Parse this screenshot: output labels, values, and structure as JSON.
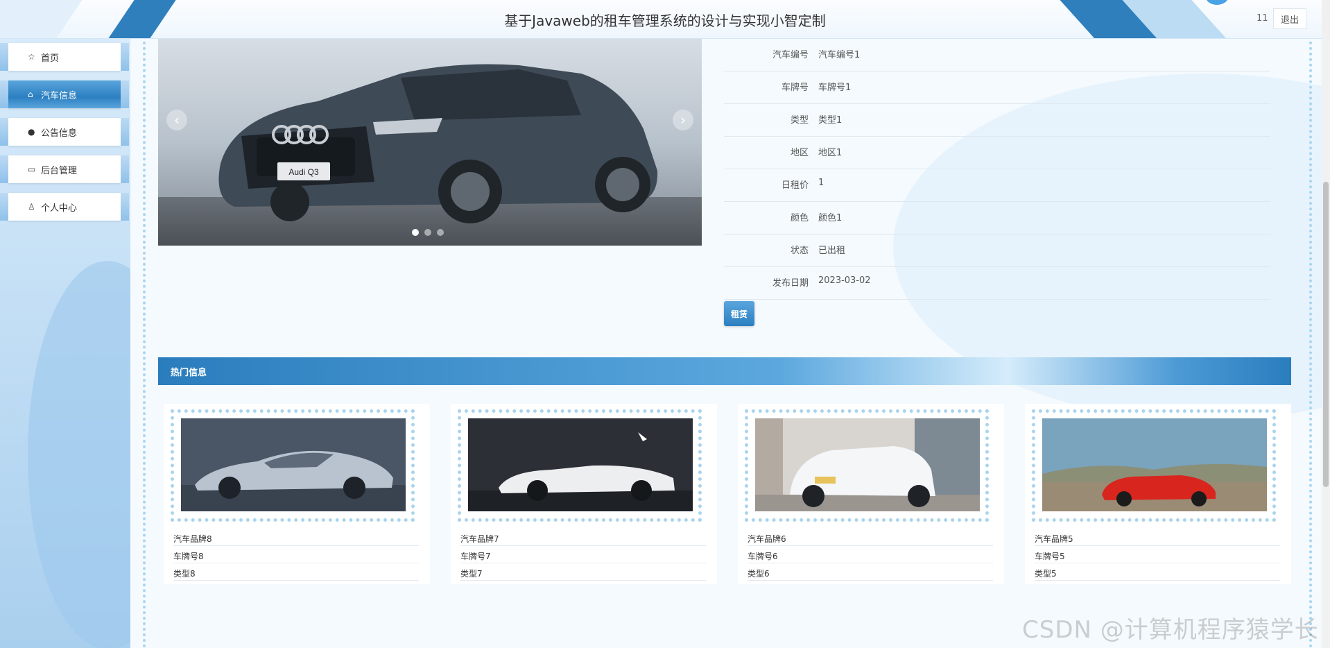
{
  "header": {
    "title": "基于Javaweb的租车管理系统的设计与实现小智定制",
    "user_id": "11",
    "logout_label": "退出"
  },
  "sidebar": {
    "items": [
      {
        "label": "首页",
        "icon": "star-icon",
        "active": false
      },
      {
        "label": "汽车信息",
        "icon": "home-icon",
        "active": true
      },
      {
        "label": "公告信息",
        "icon": "info-icon",
        "active": false
      },
      {
        "label": "后台管理",
        "icon": "briefcase-icon",
        "active": false
      },
      {
        "label": "个人中心",
        "icon": "user-icon",
        "active": false
      }
    ]
  },
  "carousel": {
    "badge": "Audi Q3",
    "prev_glyph": "‹",
    "next_glyph": "›",
    "dots": 3,
    "active_dot": 0
  },
  "detail": {
    "rows": [
      {
        "label": "汽车编号",
        "value": "汽车编号1"
      },
      {
        "label": "车牌号",
        "value": "车牌号1"
      },
      {
        "label": "类型",
        "value": "类型1"
      },
      {
        "label": "地区",
        "value": "地区1"
      },
      {
        "label": "日租价",
        "value": "1"
      },
      {
        "label": "颜色",
        "value": "颜色1"
      },
      {
        "label": "状态",
        "value": "已出租"
      },
      {
        "label": "发布日期",
        "value": "2023-03-02"
      }
    ],
    "rent_label": "租赁"
  },
  "hot": {
    "title": "热门信息",
    "cards": [
      {
        "brand": "汽车品牌8",
        "plate": "车牌号8",
        "type": "类型8"
      },
      {
        "brand": "汽车品牌7",
        "plate": "车牌号7",
        "type": "类型7"
      },
      {
        "brand": "汽车品牌6",
        "plate": "车牌号6",
        "type": "类型6"
      },
      {
        "brand": "汽车品牌5",
        "plate": "车牌号5",
        "type": "类型5"
      }
    ]
  },
  "watermark": "CSDN @计算机程序猿学长",
  "colors": {
    "accent": "#2c7fc0",
    "accent_light": "#5aa5dd",
    "frame_dots": "#a9d4ef"
  }
}
